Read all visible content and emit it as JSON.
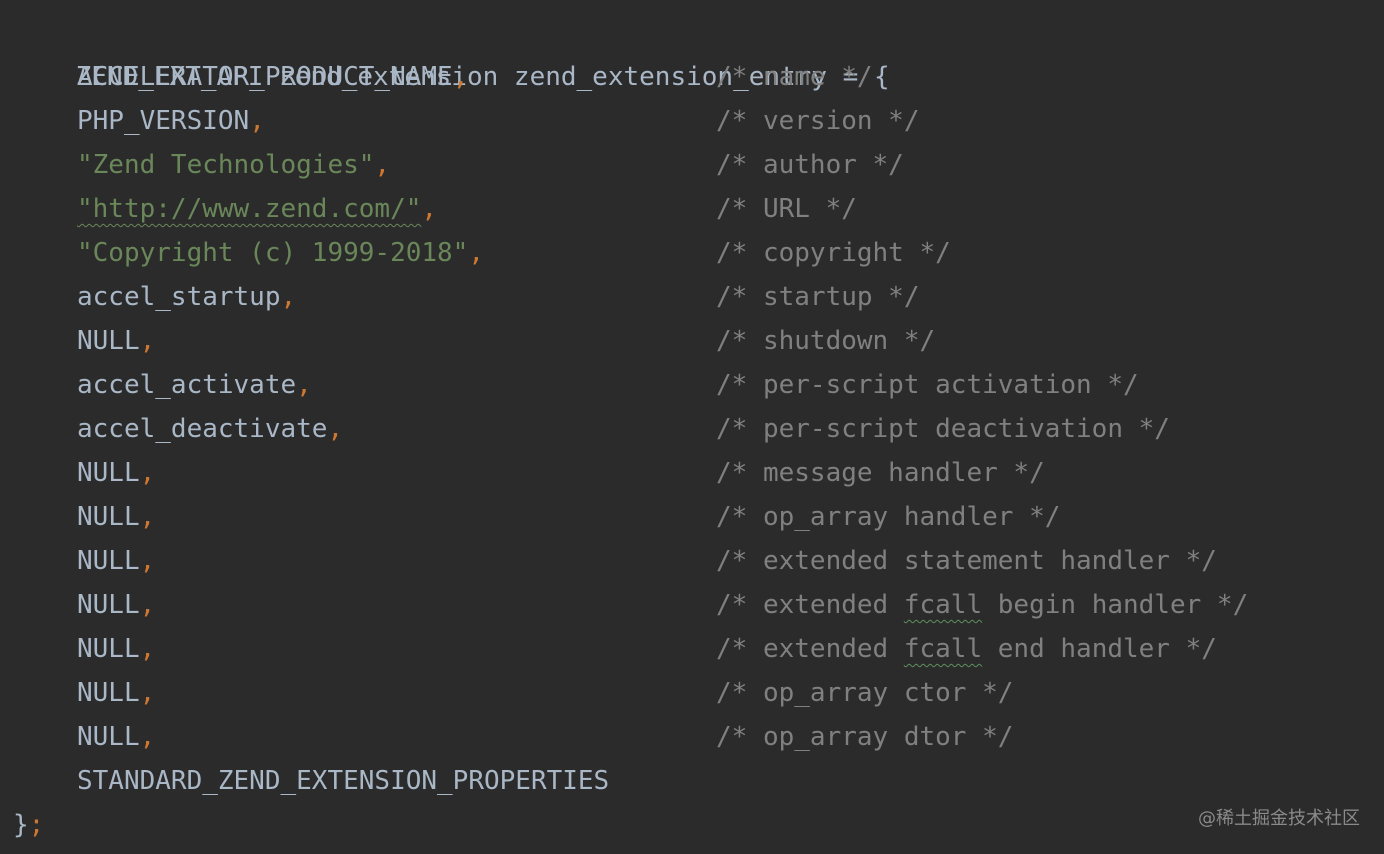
{
  "colors": {
    "background": "#2b2b2b",
    "identifier": "#a9b7c6",
    "string": "#6a8759",
    "punctuation": "#cc7832",
    "comment": "#808080"
  },
  "code": {
    "header": "ZEND_EXT_API zend_extension zend_extension_entry = {",
    "entries": [
      {
        "value": "ACCELERATOR_PRODUCT_NAME",
        "sep": ",",
        "comment": "/* name */"
      },
      {
        "value": "PHP_VERSION",
        "sep": ",",
        "comment": "/* version */"
      },
      {
        "value": "\"Zend Technologies\"",
        "sep": ",",
        "comment": "/* author */"
      },
      {
        "value": "\"http://www.zend.com/\"",
        "sep": ",",
        "comment": "/* URL */"
      },
      {
        "value": "\"Copyright (c) 1999-2018\"",
        "sep": ",",
        "comment": "/* copyright */"
      },
      {
        "value": "accel_startup",
        "sep": ",",
        "comment": "/* startup */"
      },
      {
        "value": "NULL",
        "sep": ",",
        "comment": "/* shutdown */"
      },
      {
        "value": "accel_activate",
        "sep": ",",
        "comment": "/* per-script activation */"
      },
      {
        "value": "accel_deactivate",
        "sep": ",",
        "comment": "/* per-script deactivation */"
      },
      {
        "value": "NULL",
        "sep": ",",
        "comment": "/* message handler */"
      },
      {
        "value": "NULL",
        "sep": ",",
        "comment": "/* op_array handler */"
      },
      {
        "value": "NULL",
        "sep": ",",
        "comment": "/* extended statement handler */"
      },
      {
        "value": "NULL",
        "sep": ",",
        "comment_pre": "/* extended ",
        "comment_word": "fcall",
        "comment_post": " begin handler */"
      },
      {
        "value": "NULL",
        "sep": ",",
        "comment_pre": "/* extended ",
        "comment_word": "fcall",
        "comment_post": " end handler */"
      },
      {
        "value": "NULL",
        "sep": ",",
        "comment": "/* op_array ctor */"
      },
      {
        "value": "NULL",
        "sep": ",",
        "comment": "/* op_array dtor */"
      },
      {
        "value": "STANDARD_ZEND_EXTENSION_PROPERTIES",
        "sep": "",
        "comment": ""
      }
    ],
    "closing_brace": "}",
    "closing_semicolon": ";"
  },
  "watermark": "@稀土掘金技术社区"
}
